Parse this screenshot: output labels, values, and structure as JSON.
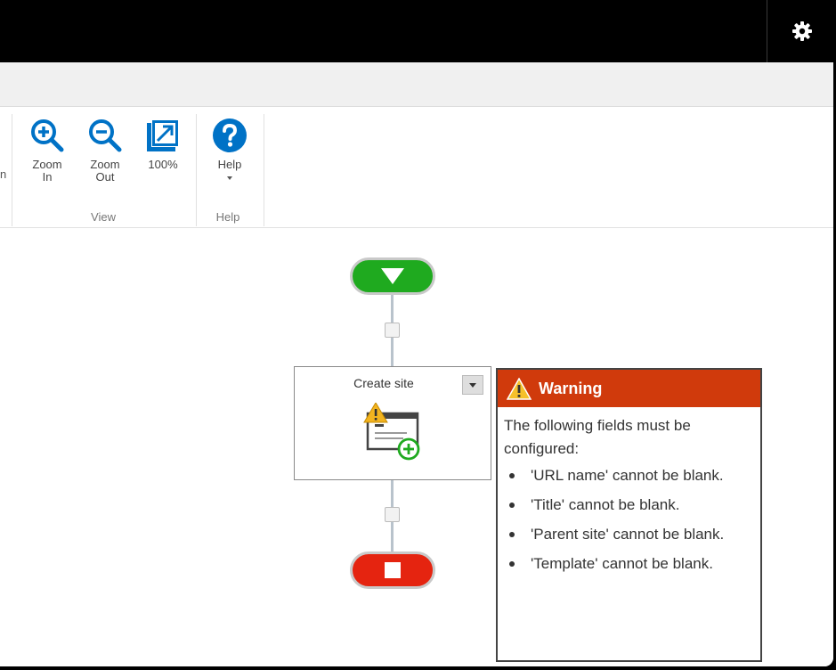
{
  "ribbon": {
    "zoom_in": {
      "line1": "Zoom",
      "line2": "In"
    },
    "zoom_out": {
      "line1": "Zoom",
      "line2": "Out"
    },
    "zoom_100": {
      "label": "100%"
    },
    "view_group": "View",
    "help_button": "Help",
    "help_group": "Help",
    "truncated_left": "n"
  },
  "workflow": {
    "action_title": "Create site"
  },
  "warning": {
    "title": "Warning",
    "message": "The following fields must be configured:",
    "items": [
      "'URL name' cannot be blank.",
      "'Title' cannot be blank.",
      "'Parent site' cannot be blank.",
      "'Template' cannot be blank."
    ]
  },
  "icons": {
    "settings": "gear-icon",
    "zoom_in": "zoom-in-icon",
    "zoom_out": "zoom-out-icon",
    "actual_size": "expand-icon",
    "help": "help-icon",
    "start": "triangle-down-icon",
    "stop": "stop-square-icon",
    "site": "create-site-icon",
    "alert": "warning-icon"
  },
  "colors": {
    "accent_blue": "#0072c6",
    "start_green": "#1faa1f",
    "stop_red": "#e52410",
    "warning_header": "#d03a0c"
  }
}
